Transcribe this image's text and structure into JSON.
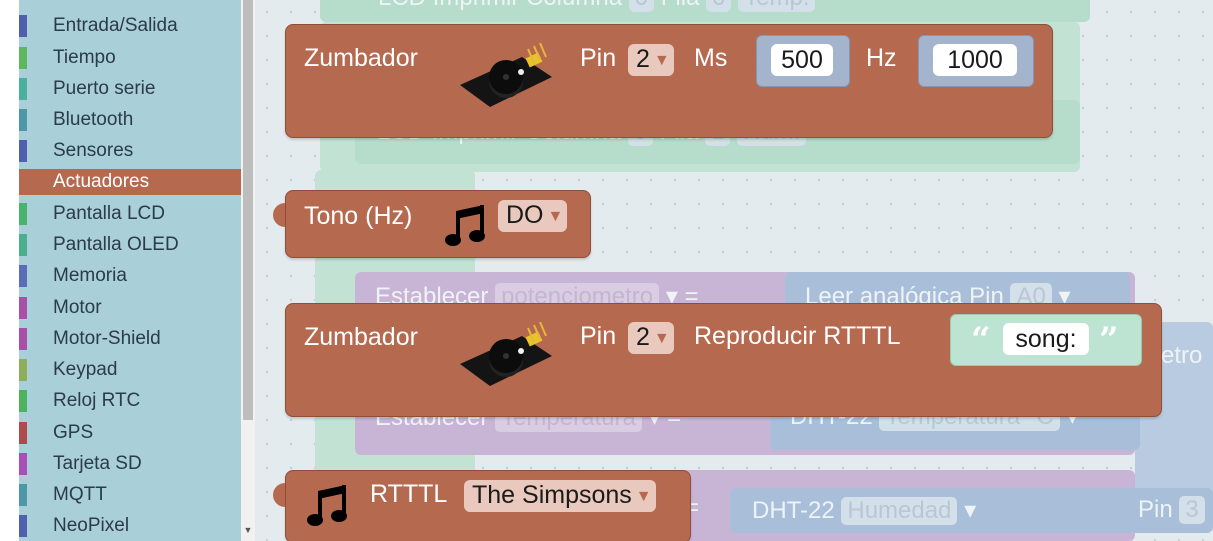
{
  "sidebar": {
    "items": [
      {
        "label": "Entrada/Salida",
        "color": "#4d5fae"
      },
      {
        "label": "Tiempo",
        "color": "#5cb85c"
      },
      {
        "label": "Puerto serie",
        "color": "#4aaf9c"
      },
      {
        "label": "Bluetooth",
        "color": "#4d98a8"
      },
      {
        "label": "Sensores",
        "color": "#5060b0"
      },
      {
        "label": "Actuadores",
        "color": "#b5694f",
        "selected": true
      },
      {
        "label": "Pantalla LCD",
        "color": "#4ab36b"
      },
      {
        "label": "Pantalla OLED",
        "color": "#4aaf8c"
      },
      {
        "label": "Memoria",
        "color": "#5a6db8"
      },
      {
        "label": "Motor",
        "color": "#a94fa8"
      },
      {
        "label": "Motor-Shield",
        "color": "#a94fa8"
      },
      {
        "label": "Keypad",
        "color": "#8fae5a"
      },
      {
        "label": "Reloj RTC",
        "color": "#4ab35c"
      },
      {
        "label": "GPS",
        "color": "#b04a4a"
      },
      {
        "label": "Tarjeta SD",
        "color": "#a94fb8"
      },
      {
        "label": "MQTT",
        "color": "#4d98a8"
      },
      {
        "label": "NeoPixel",
        "color": "#5060b0"
      }
    ]
  },
  "blocks": {
    "buzzer_tone": {
      "title": "Zumbador",
      "pin_label": "Pin",
      "pin_value": "2",
      "ms_label": "Ms",
      "ms_value": "500",
      "hz_label": "Hz",
      "hz_value": "1000"
    },
    "tone_hz": {
      "title": "Tono (Hz)",
      "note_value": "DO"
    },
    "buzzer_rtttl": {
      "title": "Zumbador",
      "pin_label": "Pin",
      "pin_value": "2",
      "action_label": "Reproducir RTTTL",
      "song_text": "song:"
    },
    "rtttl": {
      "title": "RTTTL",
      "song_value": "The Simpsons"
    }
  },
  "background_blocks": {
    "lcd_top": {
      "text": "LCD Imprimir Columna",
      "field1": "0",
      "fila": "Fila",
      "field2": "0",
      "temp": "Temp:"
    },
    "lcd_mid": {
      "text": "LCD Imprimir Columna",
      "field1": "0",
      "fila": "Fila",
      "field2": "1",
      "hum": "Hum:"
    },
    "set_pot": {
      "text": "Establecer",
      "var": "potenciometro",
      "eq": "=",
      "read": "Leer analógica Pin",
      "pin": "A0"
    },
    "metro": {
      "text": "etro"
    },
    "set_temp": {
      "text": "Establecer",
      "var": "Temperatura",
      "eq": "=",
      "sensor": "DHT-22",
      "field": "Temperatura °C"
    },
    "hum_row": {
      "sensor": "DHT-22",
      "field": "Humedad",
      "pin_label": "Pin",
      "pin": "3",
      "eq": "="
    }
  },
  "icons": {
    "buzzer": "buzzer-module-image",
    "note": "music-note-icon",
    "dropdown": "dropdown-arrow-icon"
  }
}
